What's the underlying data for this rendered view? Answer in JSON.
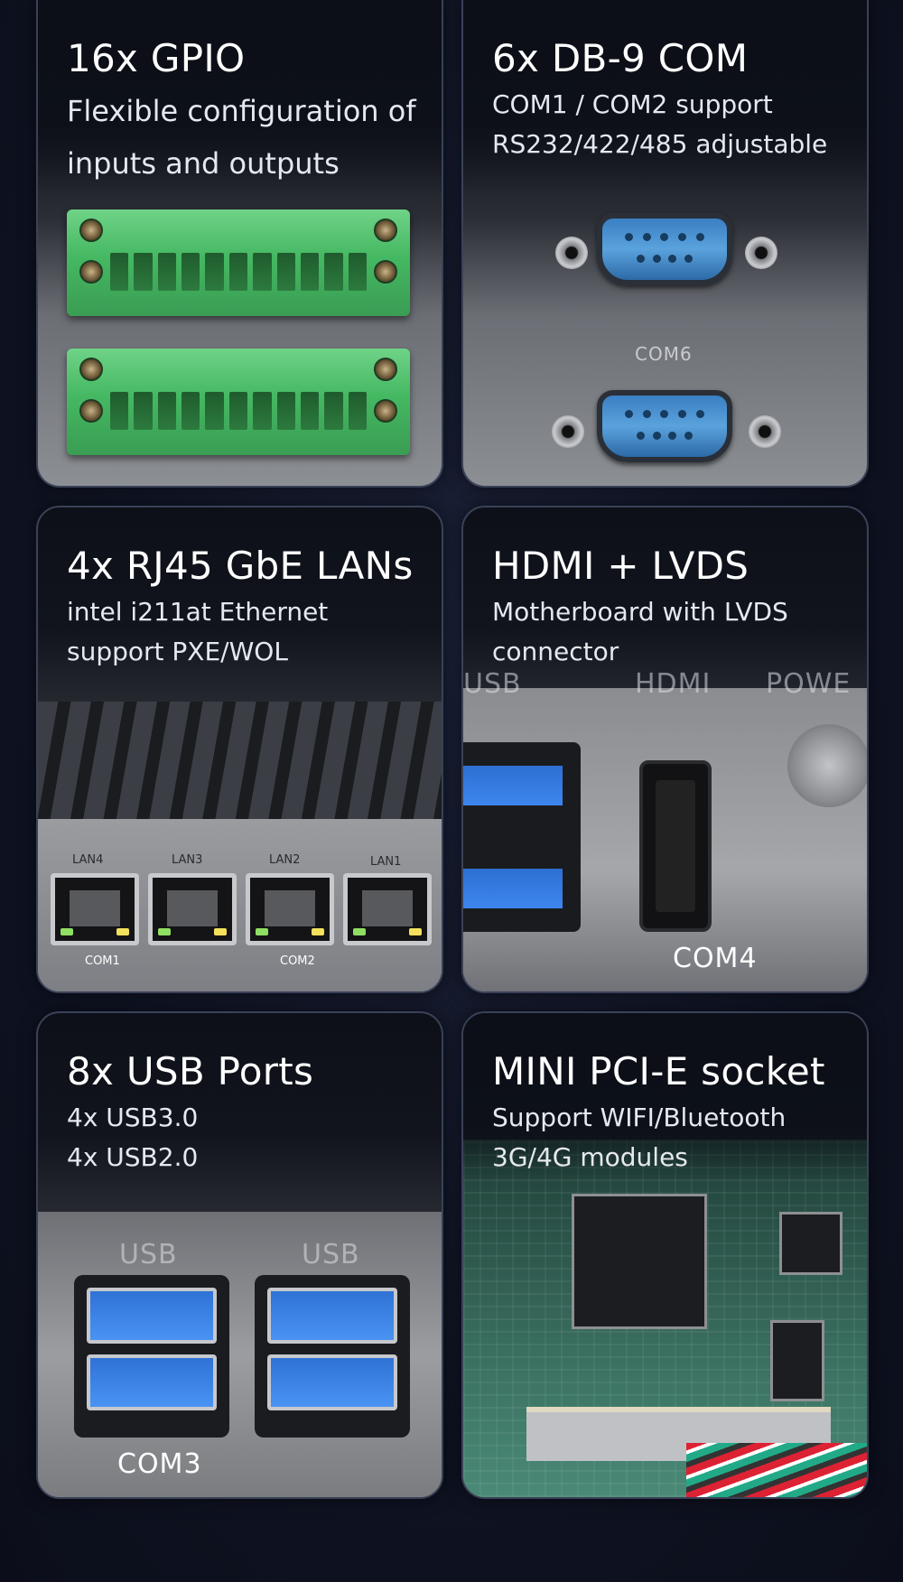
{
  "cards": [
    {
      "title": "16x GPIO",
      "desc": "Flexible configuration of\ninputs and outputs"
    },
    {
      "title": "6x DB-9 COM",
      "desc": "COM1 / COM2 support\nRS232/422/485 adjustable",
      "photo_label": "COM6"
    },
    {
      "title": "4x RJ45 GbE LANs",
      "desc": "intel i211at Ethernet\nsupport PXE/WOL",
      "port_labels": [
        "LAN4",
        "LAN3",
        "LAN2",
        "LAN1"
      ],
      "bottom_labels": [
        "COM1",
        "COM2"
      ]
    },
    {
      "title": "HDMI + LVDS",
      "desc": "Motherboard with LVDS\nconnector",
      "photo_labels": [
        "USB",
        "HDMI",
        "POWE",
        "COM4"
      ]
    },
    {
      "title": "8x USB Ports",
      "desc": "4x USB3.0\n4x USB2.0",
      "photo_labels": [
        "USB",
        "USB",
        "COM3"
      ]
    },
    {
      "title": "MINI PCI-E socket",
      "desc": "Support WIFI/Bluetooth\n3G/4G modules"
    }
  ],
  "colors": {
    "background": "#0f1322",
    "card_border": "#3a4258",
    "terminal_green": "#45b862",
    "port_blue": "#3d86ee"
  }
}
